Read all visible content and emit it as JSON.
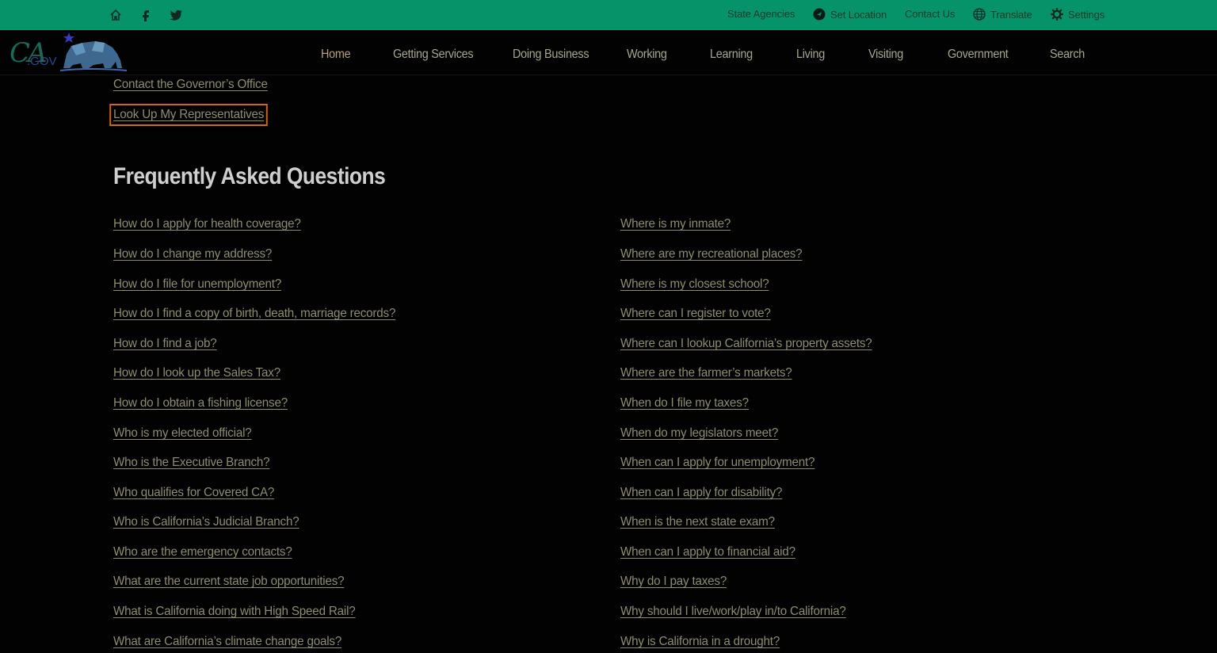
{
  "utility": {
    "home_icon": "home-icon",
    "facebook_icon": "facebook-icon",
    "twitter_icon": "twitter-icon",
    "state_agencies": "State Agencies",
    "set_location": "Set Location",
    "contact_us": "Contact Us",
    "translate": "Translate",
    "settings": "Settings"
  },
  "logo": {
    "text": "CA.GOV"
  },
  "nav": {
    "items": [
      "Home",
      "Getting Services",
      "Doing Business",
      "Working",
      "Learning",
      "Living",
      "Visiting",
      "Government",
      "Search"
    ],
    "active": "Home"
  },
  "top_links": [
    "Contact the Governor’s Office",
    "Look Up My Representatives"
  ],
  "faq": {
    "title": "Frequently Asked Questions",
    "left": [
      "How do I apply for health coverage?",
      "How do I change my address?",
      "How do I file for unemployment?",
      "How do I find a copy of birth, death, marriage records?",
      "How do I find a job?",
      "How do I look up the Sales Tax?",
      "How do I obtain a fishing license?",
      "Who is my elected official?",
      "Who is the Executive Branch?",
      "Who qualifies for Covered CA?",
      "Who is California’s Judicial Branch?",
      "Who are the emergency contacts?",
      "What are the current state job opportunities?",
      "What is California doing with High Speed Rail?",
      "What are California’s climate change goals?"
    ],
    "right": [
      "Where is my inmate?",
      "Where are my recreational places?",
      "Where is my closest school?",
      "Where can I register to vote?",
      "Where can I lookup California’s property assets?",
      "Where are the farmer’s markets?",
      "When do I file my taxes?",
      "When do my legislators meet?",
      "When can I apply for unemployment?",
      "When can I apply for disability?",
      "When is the next state exam?",
      "When can I apply to financial aid?",
      "Why do I pay taxes?",
      "Why should I live/work/play in/to California?",
      "Why is California in a drought?"
    ]
  },
  "colors": {
    "utility_bar": "#06936a",
    "background": "#020202",
    "link": "#8d8d6e",
    "focus_outline": "#d2661c"
  }
}
